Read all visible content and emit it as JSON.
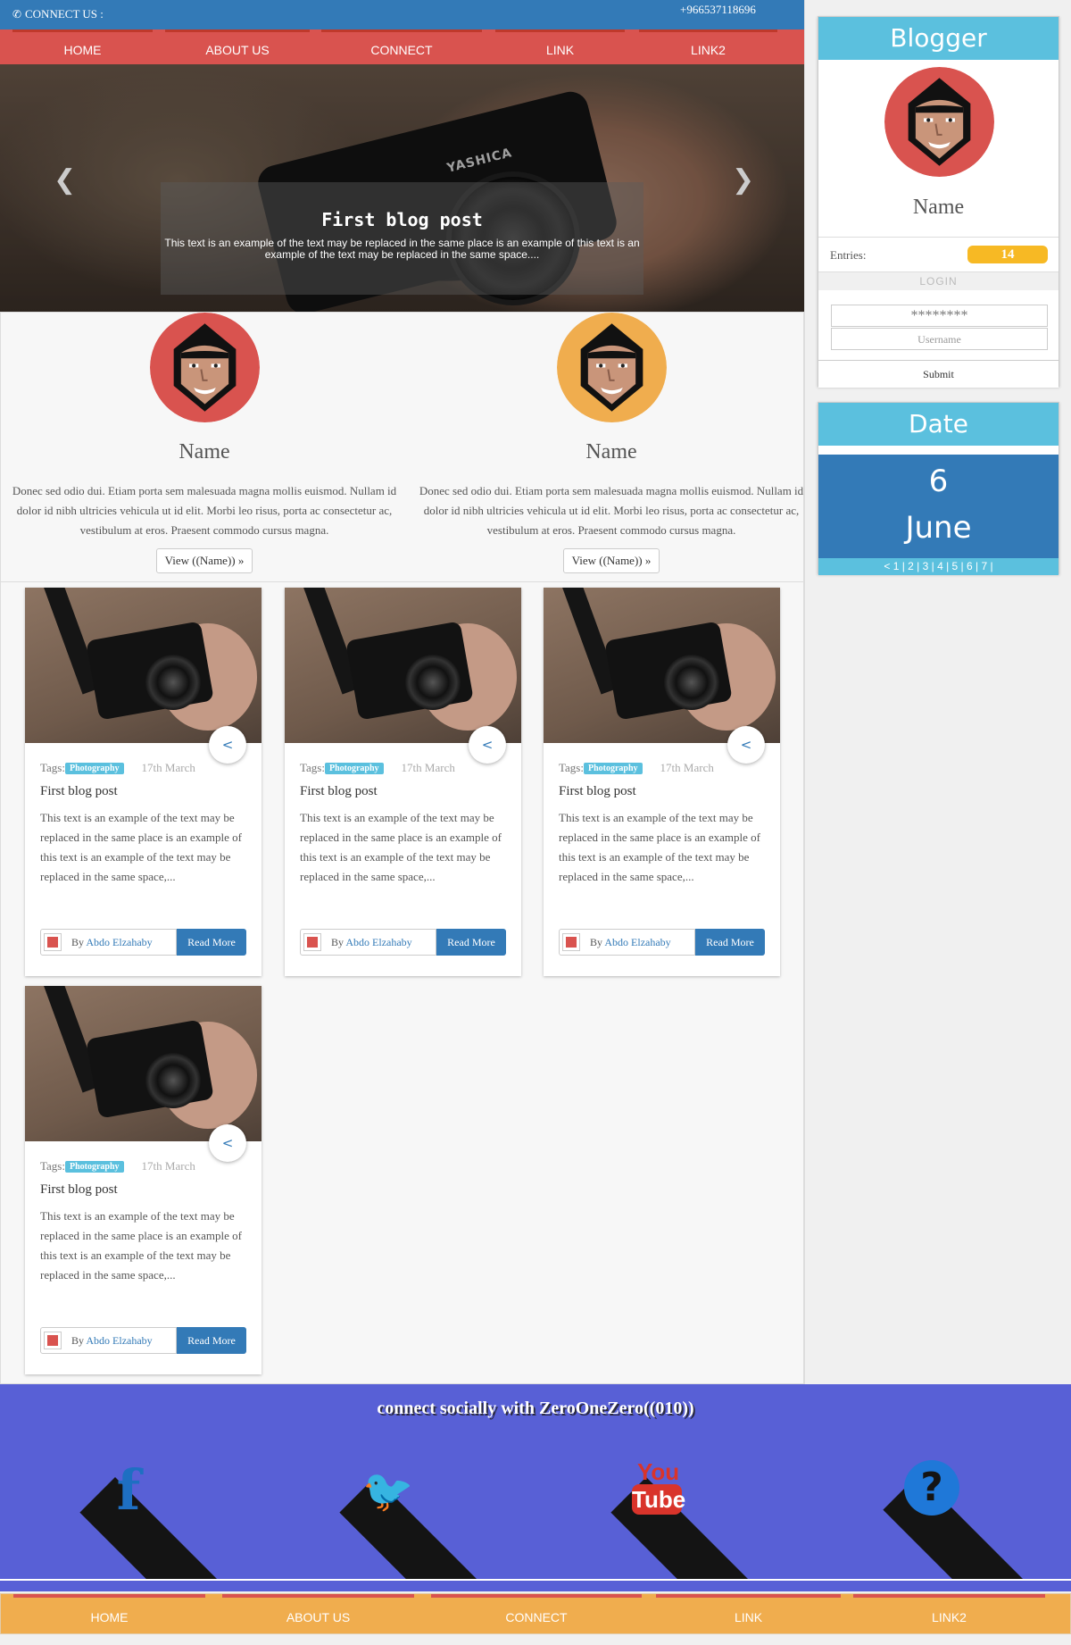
{
  "topbar": {
    "connect_icon": "phone-icon",
    "connect_label": "CONNECT US :",
    "phone": "+966537118696"
  },
  "nav": {
    "items": [
      "HOME",
      "ABOUT US",
      "CONNECT",
      "LINK",
      "LINK2"
    ]
  },
  "hero": {
    "title": "First blog post",
    "text": "This text is an example of the text may be replaced in the same place is an example of this text is an example of the text may be replaced in the same space....",
    "camera_brand": "YASHICA"
  },
  "profiles": [
    {
      "name": "Name",
      "avatar_color": "#d9534f",
      "text": "Donec sed odio dui. Etiam porta sem malesuada magna mollis euismod. Nullam id dolor id nibh ultricies vehicula ut id elit. Morbi leo risus, porta ac consectetur ac, vestibulum at eros. Praesent commodo cursus magna.",
      "button": "View ((Name)) »"
    },
    {
      "name": "Name",
      "avatar_color": "#f0ad4e",
      "text": "Donec sed odio dui. Etiam porta sem malesuada magna mollis euismod. Nullam id dolor id nibh ultricies vehicula ut id elit. Morbi leo risus, porta ac consectetur ac, vestibulum at eros. Praesent commodo cursus magna.",
      "button": "View ((Name)) »"
    }
  ],
  "posts": [
    {
      "tags_label": "Tags:",
      "tag": "Photography",
      "date": "17th March",
      "title": "First blog post",
      "text": "This text is an example of the text may be replaced in the same place is an example of this text is an example of the text may be replaced in the same space,...",
      "by": "By",
      "author": "Abdo Elzahaby",
      "read_more": "Read More"
    },
    {
      "tags_label": "Tags:",
      "tag": "Photography",
      "date": "17th March",
      "title": "First blog post",
      "text": "This text is an example of the text may be replaced in the same place is an example of this text is an example of the text may be replaced in the same space,...",
      "by": "By",
      "author": "Abdo Elzahaby",
      "read_more": "Read More"
    },
    {
      "tags_label": "Tags:",
      "tag": "Photography",
      "date": "17th March",
      "title": "First blog post",
      "text": "This text is an example of the text may be replaced in the same place is an example of this text is an example of the text may be replaced in the same space,...",
      "by": "By",
      "author": "Abdo Elzahaby",
      "read_more": "Read More"
    },
    {
      "tags_label": "Tags:",
      "tag": "Photography",
      "date": "17th March",
      "title": "First blog post",
      "text": "This text is an example of the text may be replaced in the same place is an example of this text is an example of the text may be replaced in the same space,...",
      "by": "By",
      "author": "Abdo Elzahaby",
      "read_more": "Read More"
    }
  ],
  "sidebar": {
    "blogger": {
      "title": "Blogger",
      "name": "Name",
      "entries_label": "Entries:",
      "entries_count": "14",
      "login_label": "LOGIN",
      "password_value": "********",
      "username_placeholder": "Username",
      "submit_label": "Submit"
    },
    "date": {
      "title": "Date",
      "day": "6",
      "month": "June",
      "pager": "< 1 | 2 | 3 | 4 | 5 | 6 | 7 |"
    }
  },
  "social": {
    "title": "connect socially with ZeroOneZero((010))",
    "icons": [
      "facebook-icon",
      "twitter-icon",
      "youtube-icon",
      "help-icon"
    ],
    "youtube_you": "You",
    "youtube_tube": "Tube"
  },
  "footer": {
    "items": [
      "HOME",
      "ABOUT US",
      "CONNECT",
      "LINK",
      "LINK2"
    ]
  },
  "colors": {
    "primary": "#337ab7",
    "nav": "#d9534f",
    "info": "#5bc0de",
    "warning": "#f0ad4e",
    "social_bg": "#5860d6"
  }
}
